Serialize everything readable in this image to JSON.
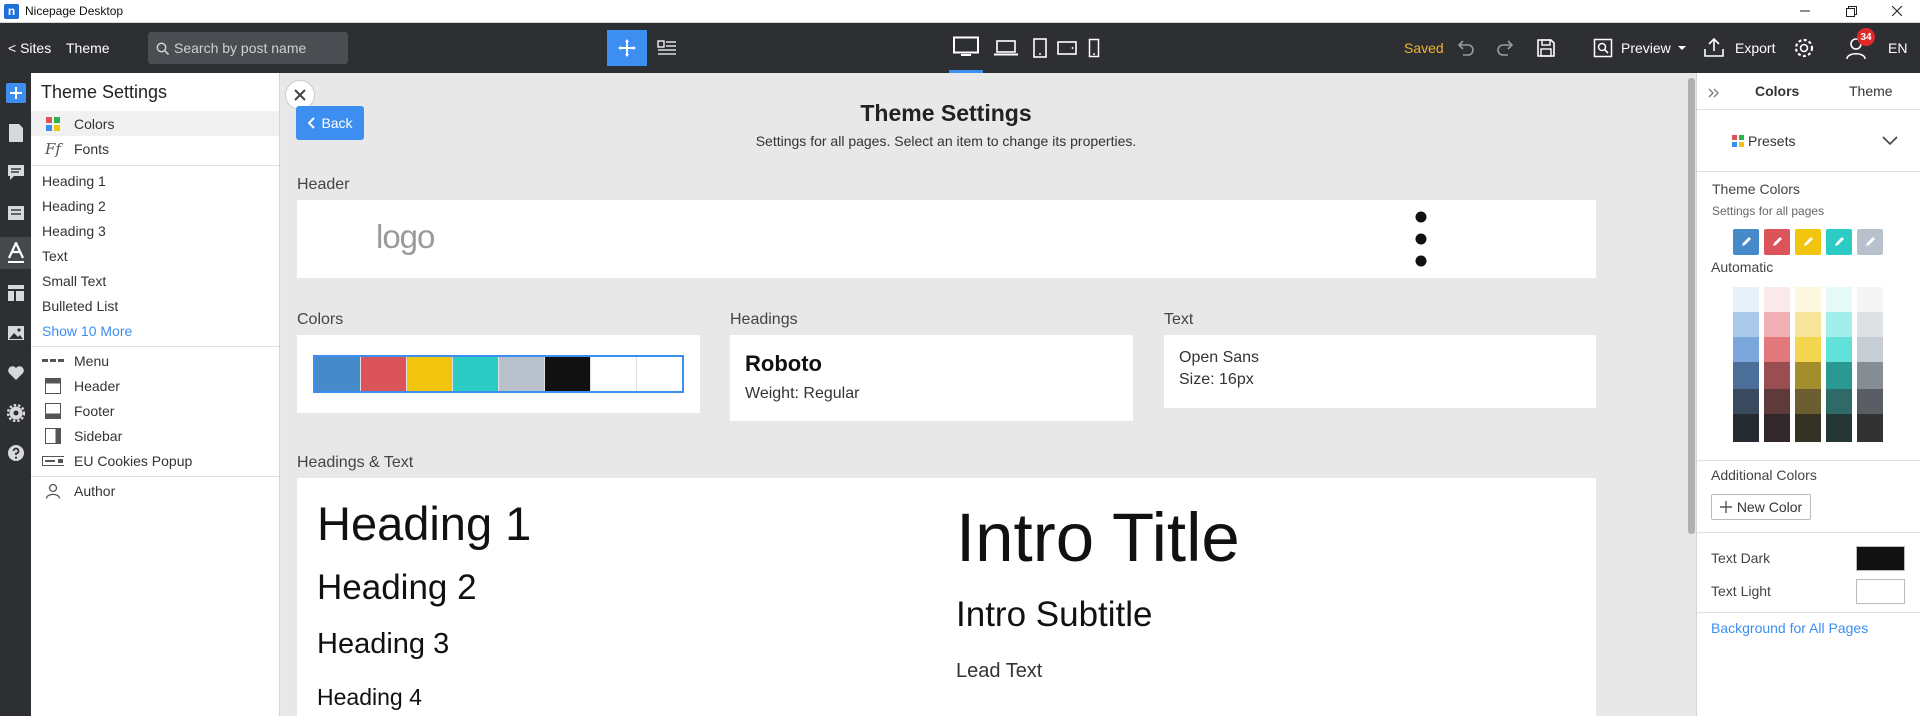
{
  "window": {
    "title": "Nicepage Desktop",
    "logo_letter": "n"
  },
  "toolbar": {
    "sites": "< Sites",
    "theme": "Theme",
    "search_placeholder": "Search by post name",
    "saved": "Saved",
    "preview": "Preview",
    "export": "Export",
    "notifications": "34",
    "language": "EN"
  },
  "left_panel": {
    "title": "Theme Settings",
    "items_top": [
      "Colors",
      "Fonts"
    ],
    "items_text": [
      "Heading 1",
      "Heading 2",
      "Heading 3",
      "Text",
      "Small Text",
      "Bulleted List"
    ],
    "show_more": "Show 10 More",
    "items_blocks": [
      "Menu",
      "Header",
      "Footer",
      "Sidebar",
      "EU Cookies Popup"
    ],
    "author": "Author"
  },
  "canvas": {
    "back": "Back",
    "title": "Theme Settings",
    "subtitle": "Settings for all pages. Select an item to change its properties.",
    "header_label": "Header",
    "logo_text": "logo",
    "colors_label": "Colors",
    "swatches": [
      "#478ac9",
      "#db545a",
      "#f1c50e",
      "#2cccc4",
      "#b9c1cc",
      "#111111",
      "#ffffff",
      "#ffffff"
    ],
    "headings_label": "Headings",
    "headings_font": "Roboto",
    "headings_weight": "Weight: Regular",
    "text_label": "Text",
    "text_font": "Open Sans",
    "text_size": "Size: 16px",
    "ht_label": "Headings & Text",
    "h1": "Heading 1",
    "h2": "Heading 2",
    "h3": "Heading 3",
    "h4": "Heading 4",
    "intro_title": "Intro Title",
    "intro_subtitle": "Intro Subtitle",
    "lead_text": "Lead Text"
  },
  "right_panel": {
    "tab_colors": "Colors",
    "tab_theme": "Theme",
    "presets": "Presets",
    "theme_colors": "Theme Colors",
    "settings_all": "Settings for all pages",
    "automatic": "Automatic",
    "theme_palette": [
      "#478ac9",
      "#db545a",
      "#f1c50e",
      "#2cccc4",
      "#b9c1cc"
    ],
    "shades": [
      [
        "#e8f0fa",
        "#aac8ea",
        "#7ba7dc",
        "#4c6f99",
        "#3a4a5e",
        "#262b31"
      ],
      [
        "#faeaea",
        "#eeb0b2",
        "#e3787b",
        "#9a4e51",
        "#5f3a3b",
        "#322829"
      ],
      [
        "#fdf7df",
        "#f8e49a",
        "#f4d54e",
        "#a38e2e",
        "#6b5f31",
        "#353125"
      ],
      [
        "#e5faf9",
        "#a2eeea",
        "#62e0da",
        "#2a9893",
        "#2f6a67",
        "#243635"
      ],
      [
        "#f3f5f7",
        "#dde1e6",
        "#c7cdd5",
        "#868c93",
        "#595e64",
        "#303234"
      ]
    ],
    "additional_colors": "Additional Colors",
    "new_color": "New Color",
    "text_dark": "Text Dark",
    "text_light": "Text Light",
    "text_dark_color": "#111111",
    "text_light_color": "#ffffff",
    "background_link": "Background for All Pages"
  }
}
